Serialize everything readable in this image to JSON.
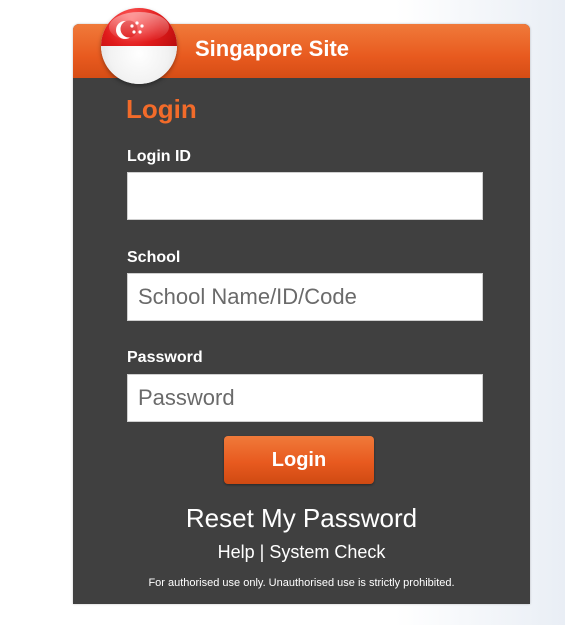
{
  "header": {
    "site_title": "Singapore Site",
    "flag_icon": "singapore-flag-icon"
  },
  "form": {
    "heading": "Login",
    "login_id": {
      "label": "Login ID",
      "value": "",
      "placeholder": ""
    },
    "school": {
      "label": "School",
      "value": "",
      "placeholder": "School Name/ID/Code"
    },
    "password": {
      "label": "Password",
      "value": "",
      "placeholder": "Password"
    },
    "submit_label": "Login"
  },
  "links": {
    "reset_password": "Reset My Password",
    "help": "Help",
    "separator": "|",
    "system_check": "System Check"
  },
  "footer": {
    "disclaimer": "For authorised use only. Unauthorised use is strictly prohibited."
  },
  "colors": {
    "accent_orange": "#e85a1f",
    "panel_background": "#404040",
    "heading_orange": "#f26b2a"
  }
}
